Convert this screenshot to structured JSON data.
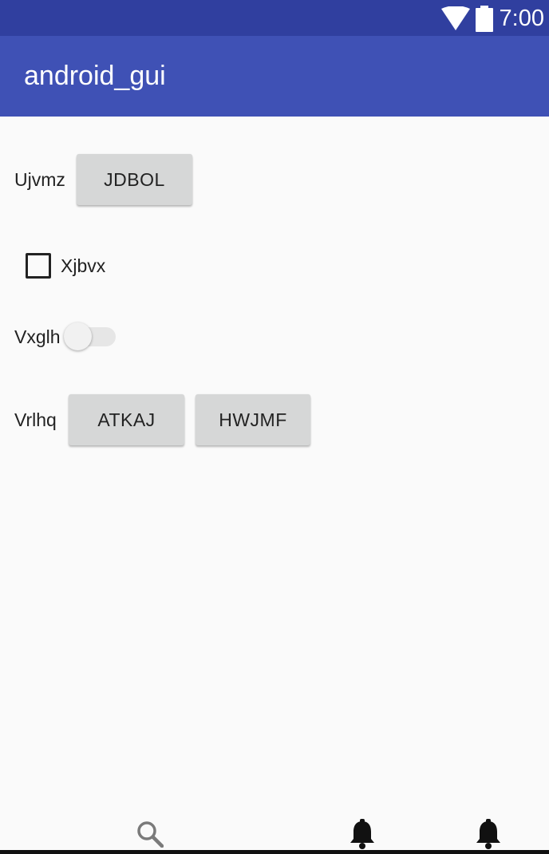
{
  "status_bar": {
    "time": "7:00",
    "wifi_icon": "wifi-icon",
    "battery_icon": "battery-icon",
    "color": "#303f9f"
  },
  "app_bar": {
    "title": "android_gui",
    "color": "#3f51b5"
  },
  "rows": {
    "row1": {
      "label": "Ujvmz",
      "button": "JDBOL"
    },
    "checkbox": {
      "label": "Xjbvx",
      "checked": false
    },
    "switch": {
      "label": "Vxglh",
      "on": false
    },
    "row4": {
      "label": "Vrlhq",
      "button1": "ATKAJ",
      "button2": "HWJMF"
    }
  },
  "bottom_nav": {
    "items": [
      {
        "icon": "search-icon"
      },
      {
        "icon": "bell-icon"
      },
      {
        "icon": "bell-icon"
      }
    ]
  }
}
